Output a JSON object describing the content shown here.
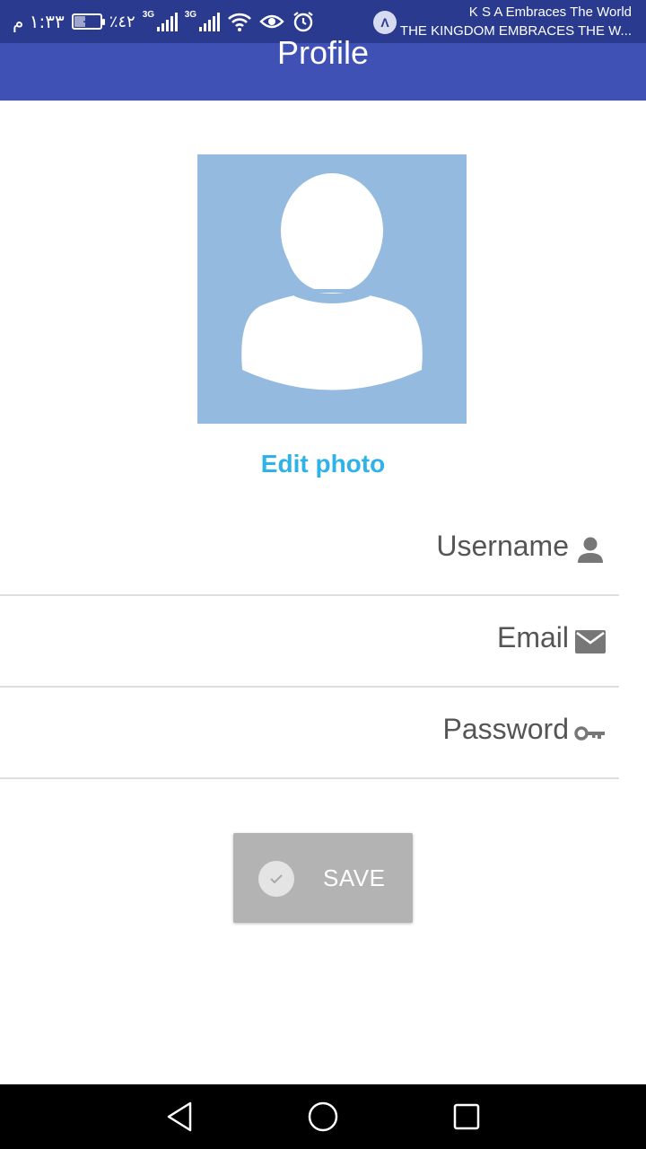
{
  "status_bar": {
    "time": "١:٣٣ م",
    "battery_percent": "٪٤٢",
    "network_type_1": "3G",
    "network_type_2": "3G",
    "notification_line1": "K S A Embraces The World",
    "notification_line2": "THE KINGDOM EMBRACES THE W...",
    "icons": [
      "battery-charging-icon",
      "signal-icon",
      "signal-icon",
      "wifi-icon",
      "eye-icon",
      "alarm-icon",
      "notification-app-icon"
    ]
  },
  "app_bar": {
    "title": "Profile"
  },
  "profile": {
    "avatar_icon": "person-placeholder-icon",
    "edit_photo_label": "Edit photo"
  },
  "form": {
    "fields": [
      {
        "label": "Username",
        "icon": "person-icon"
      },
      {
        "label": "Email",
        "icon": "mail-icon"
      },
      {
        "label": "Password",
        "icon": "key-icon"
      }
    ]
  },
  "save_button": {
    "label": "SAVE",
    "icon": "check-circle-icon"
  },
  "nav_bar": {
    "icons": [
      "back-icon",
      "home-icon",
      "recents-icon"
    ]
  },
  "colors": {
    "app_bar": "#3F51B5",
    "status_bar": "#2a3a8f",
    "avatar_bg": "#94BADF",
    "accent_link": "#2fb2e8",
    "save_button_bg": "#b3b3b3",
    "field_text": "#555555",
    "divider": "#dedede"
  }
}
